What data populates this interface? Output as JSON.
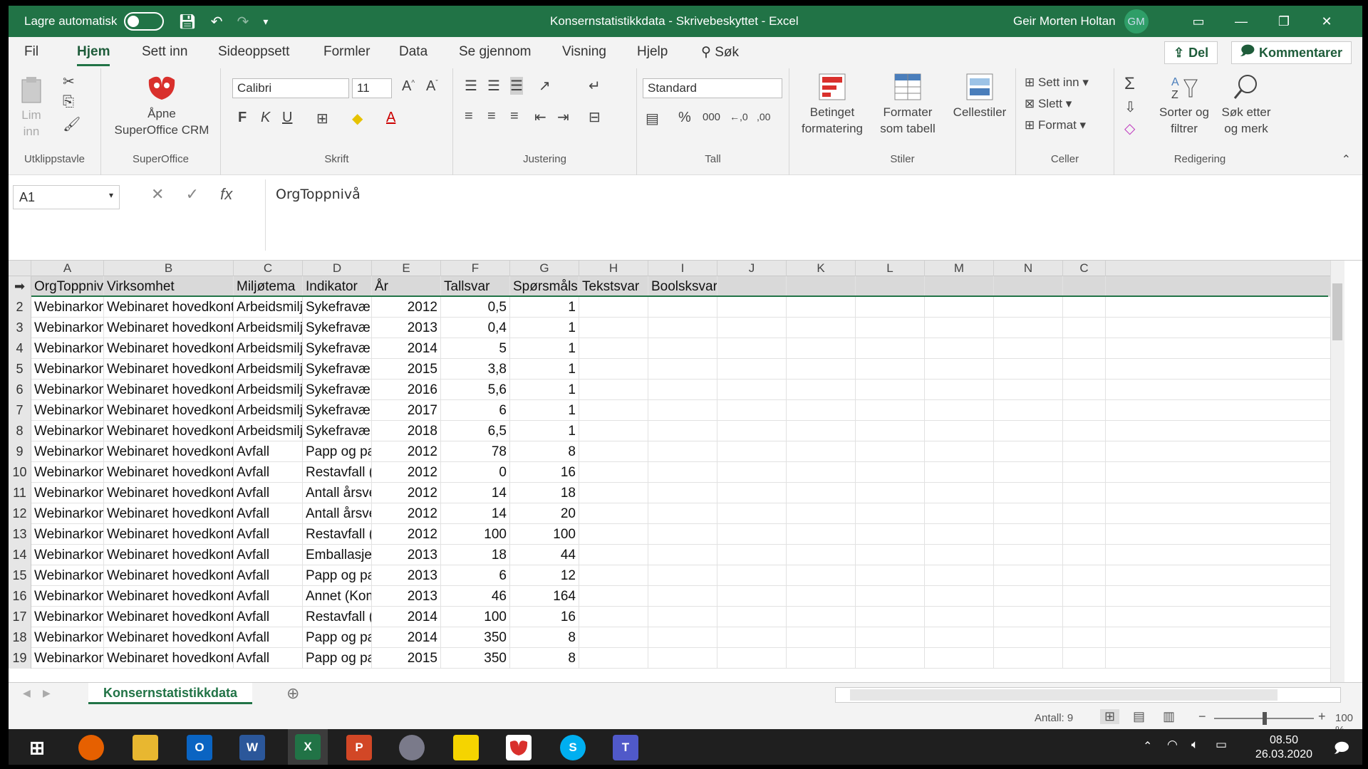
{
  "titlebar": {
    "autosave_label": "Lagre automatisk",
    "title": "Konsernstatistikkdata  -  Skrivebeskyttet  -  Excel",
    "user": "Geir Morten Holtan",
    "initials": "GM"
  },
  "menu": {
    "tabs": [
      "Fil",
      "Hjem",
      "Sett inn",
      "Sideoppsett",
      "Formler",
      "Data",
      "Se gjennom",
      "Visning",
      "Hjelp"
    ],
    "search": "Søk",
    "share": "Del",
    "comments": "Kommentarer"
  },
  "ribbon": {
    "clipboard": {
      "paste_line1": "Lim",
      "paste_line2": "inn",
      "label": "Utklippstavle"
    },
    "superoffice": {
      "line1": "Åpne",
      "line2": "SuperOffice CRM",
      "label": "SuperOffice"
    },
    "font": {
      "name": "Calibri",
      "size": "11",
      "bold": "F",
      "italic": "K",
      "underline": "U",
      "label": "Skrift"
    },
    "alignment": {
      "label": "Justering"
    },
    "number": {
      "format": "Standard",
      "label": "Tall"
    },
    "styles": {
      "cond_line1": "Betinget",
      "cond_line2": "formatering",
      "table_line1": "Formater",
      "table_line2": "som tabell",
      "cell_styles": "Cellestiler",
      "label": "Stiler"
    },
    "cells": {
      "insert": "Sett inn",
      "delete": "Slett",
      "format": "Format",
      "label": "Celler"
    },
    "editing": {
      "sort_line1": "Sorter og",
      "sort_line2": "filtrer",
      "find_line1": "Søk etter",
      "find_line2": "og merk",
      "label": "Redigering"
    }
  },
  "formula_bar": {
    "namebox": "A1",
    "content": "OrgToppnivå"
  },
  "columns": [
    "A",
    "B",
    "C",
    "D",
    "E",
    "F",
    "G",
    "H",
    "I",
    "J",
    "K",
    "L",
    "M",
    "N",
    "C"
  ],
  "header_row": [
    "OrgToppnivå",
    "Virksomhet",
    "Miljøtema",
    "Indikator",
    "År",
    "Tallsvar",
    "Spørsmålsid",
    "Tekstsvar",
    "Boolsksvar"
  ],
  "rows": [
    {
      "n": "2",
      "a": "Webinarkon:",
      "b": "Webinaret hovedkontor",
      "c": "Arbeidsmiljø",
      "d": "Sykefravær i",
      "e": "2012",
      "f": "0,5",
      "g": "1"
    },
    {
      "n": "3",
      "a": "Webinarkon:",
      "b": "Webinaret hovedkontor",
      "c": "Arbeidsmiljø",
      "d": "Sykefravær i",
      "e": "2013",
      "f": "0,4",
      "g": "1"
    },
    {
      "n": "4",
      "a": "Webinarkon:",
      "b": "Webinaret hovedkontor",
      "c": "Arbeidsmiljø",
      "d": "Sykefravær i",
      "e": "2014",
      "f": "5",
      "g": "1"
    },
    {
      "n": "5",
      "a": "Webinarkon:",
      "b": "Webinaret hovedkontor",
      "c": "Arbeidsmiljø",
      "d": "Sykefravær i",
      "e": "2015",
      "f": "3,8",
      "g": "1"
    },
    {
      "n": "6",
      "a": "Webinarkon:",
      "b": "Webinaret hovedkontor",
      "c": "Arbeidsmiljø",
      "d": "Sykefravær i",
      "e": "2016",
      "f": "5,6",
      "g": "1"
    },
    {
      "n": "7",
      "a": "Webinarkon:",
      "b": "Webinaret hovedkontor",
      "c": "Arbeidsmiljø",
      "d": "Sykefravær i",
      "e": "2017",
      "f": "6",
      "g": "1"
    },
    {
      "n": "8",
      "a": "Webinarkon:",
      "b": "Webinaret hovedkontor",
      "c": "Arbeidsmiljø",
      "d": "Sykefravær i",
      "e": "2018",
      "f": "6,5",
      "g": "1"
    },
    {
      "n": "9",
      "a": "Webinarkon:",
      "b": "Webinaret hovedkontor",
      "c": "Avfall",
      "d": "Papp og papi",
      "e": "2012",
      "f": "78",
      "g": "8"
    },
    {
      "n": "10",
      "a": "Webinarkon:",
      "b": "Webinaret hovedkontor",
      "c": "Avfall",
      "d": "Restavfall (m",
      "e": "2012",
      "f": "0",
      "g": "16"
    },
    {
      "n": "11",
      "a": "Webinarkon:",
      "b": "Webinaret hovedkontor",
      "c": "Avfall",
      "d": "Antall årsver",
      "e": "2012",
      "f": "14",
      "g": "18"
    },
    {
      "n": "12",
      "a": "Webinarkon:",
      "b": "Webinaret hovedkontor",
      "c": "Avfall",
      "d": "Antall årsver",
      "e": "2012",
      "f": "14",
      "g": "20"
    },
    {
      "n": "13",
      "a": "Webinarkon:",
      "b": "Webinaret hovedkontor",
      "c": "Avfall",
      "d": "Restavfall (kc",
      "e": "2012",
      "f": "100",
      "g": "100"
    },
    {
      "n": "14",
      "a": "Webinarkon:",
      "b": "Webinaret hovedkontor",
      "c": "Avfall",
      "d": "Emballasjepl",
      "e": "2013",
      "f": "18",
      "g": "44"
    },
    {
      "n": "15",
      "a": "Webinarkon:",
      "b": "Webinaret hovedkontor",
      "c": "Avfall",
      "d": "Papp og papi",
      "e": "2013",
      "f": "6",
      "g": "12"
    },
    {
      "n": "16",
      "a": "Webinarkon:",
      "b": "Webinaret hovedkontor",
      "c": "Avfall",
      "d": "Annet (Komr",
      "e": "2013",
      "f": "46",
      "g": "164"
    },
    {
      "n": "17",
      "a": "Webinarkon:",
      "b": "Webinaret hovedkontor",
      "c": "Avfall",
      "d": "Restavfall (m",
      "e": "2014",
      "f": "100",
      "g": "16"
    },
    {
      "n": "18",
      "a": "Webinarkon:",
      "b": "Webinaret hovedkontor",
      "c": "Avfall",
      "d": "Papp og papi",
      "e": "2014",
      "f": "350",
      "g": "8"
    },
    {
      "n": "19",
      "a": "Webinarkon:",
      "b": "Webinaret hovedkontor",
      "c": "Avfall",
      "d": "Papp og papi",
      "e": "2015",
      "f": "350",
      "g": "8"
    }
  ],
  "sheet": {
    "tab": "Konsernstatistikkdata"
  },
  "status": {
    "count": "Antall: 9",
    "zoom": "100 %"
  },
  "taskbar": {
    "time": "08.50",
    "date": "26.03.2020"
  },
  "colors": {
    "excel_green": "#217346"
  }
}
